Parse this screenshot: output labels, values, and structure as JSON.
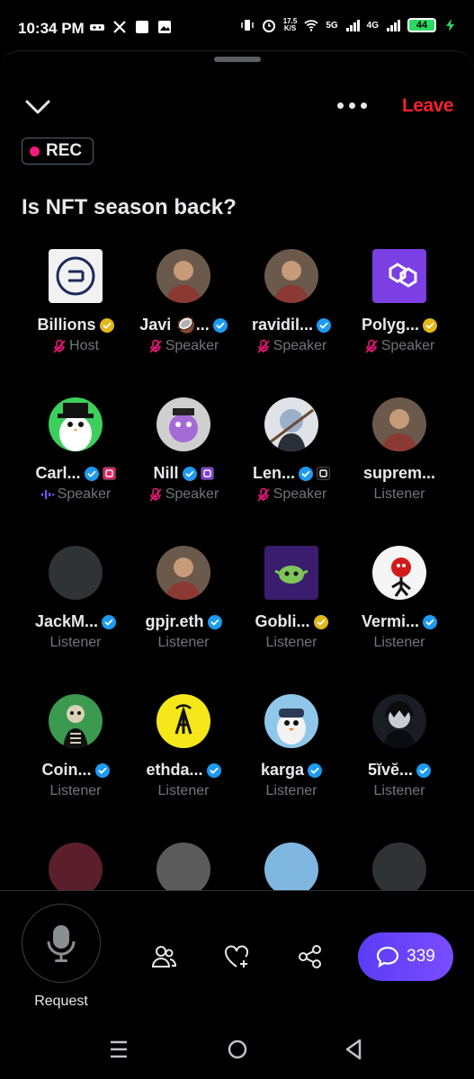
{
  "status_bar": {
    "time": "10:34 PM",
    "net_speed_value": "17.5",
    "net_speed_unit": "K/S",
    "signal_1": "5G",
    "signal_2": "4G",
    "battery": "44"
  },
  "header": {
    "leave_label": "Leave",
    "rec_label": "REC",
    "title": "Is NFT season back?"
  },
  "participants": [
    {
      "name": "Billions",
      "verified": "gold",
      "role": "Host",
      "role_icon": "mic-off-icon",
      "avatar": "billions-logo"
    },
    {
      "name": "Javi 🥥...",
      "verified": "blue",
      "role": "Speaker",
      "role_icon": "mic-off-icon",
      "avatar": "photo"
    },
    {
      "name": "ravidil...",
      "verified": "blue",
      "role": "Speaker",
      "role_icon": "mic-off-icon",
      "avatar": "photo"
    },
    {
      "name": "Polyg...",
      "verified": "gold",
      "role": "Speaker",
      "role_icon": "mic-off-icon",
      "avatar": "polygon-logo"
    },
    {
      "name": "Carl...",
      "verified": "blue",
      "role": "Speaker",
      "role_icon": "speaking-icon",
      "avatar": "penguin",
      "affiliate": "red"
    },
    {
      "name": "Nill",
      "verified": "blue",
      "role": "Speaker",
      "role_icon": "mic-off-icon",
      "avatar": "character",
      "affiliate": "purple"
    },
    {
      "name": "Len...",
      "verified": "blue",
      "role": "Speaker",
      "role_icon": "mic-off-icon",
      "avatar": "anime",
      "affiliate": "black"
    },
    {
      "name": "suprem...",
      "verified": "",
      "role": "Listener",
      "role_icon": "",
      "avatar": "photo"
    },
    {
      "name": "JackM...",
      "verified": "blue",
      "role": "Listener",
      "role_icon": "",
      "avatar": "blank"
    },
    {
      "name": "gpjr.eth",
      "verified": "blue",
      "role": "Listener",
      "role_icon": "",
      "avatar": "photo"
    },
    {
      "name": "Gobli...",
      "verified": "gold",
      "role": "Listener",
      "role_icon": "",
      "avatar": "goblin"
    },
    {
      "name": "Vermi...",
      "verified": "blue",
      "role": "Listener",
      "role_icon": "",
      "avatar": "cartoon"
    },
    {
      "name": "Coin...",
      "verified": "blue",
      "role": "Listener",
      "role_icon": "",
      "avatar": "skeleton"
    },
    {
      "name": "ethda...",
      "verified": "blue",
      "role": "Listener",
      "role_icon": "",
      "avatar": "tower-logo"
    },
    {
      "name": "karga",
      "verified": "blue",
      "role": "Listener",
      "role_icon": "",
      "avatar": "bird"
    },
    {
      "name": "5ĭvĕ...",
      "verified": "blue",
      "role": "Listener",
      "role_icon": "",
      "avatar": "dark-anime"
    }
  ],
  "bottom_bar": {
    "request_label": "Request",
    "comment_count": "339"
  },
  "colors": {
    "leave": "#f4212e",
    "rec_dot": "#f91880",
    "verified_blue": "#1d9bf0",
    "verified_gold": "#e2b719",
    "chat_button": "#6a45f9"
  }
}
